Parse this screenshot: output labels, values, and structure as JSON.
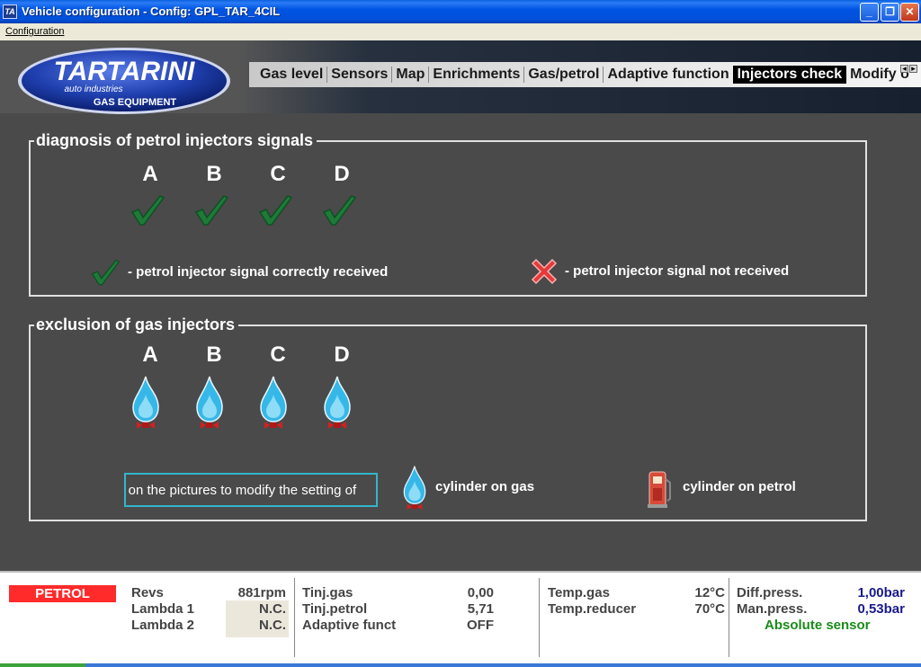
{
  "window": {
    "title": "Vehicle configuration - Config: GPL_TAR_4CIL",
    "app_icon": "TA",
    "minimize_icon": "minimize-icon",
    "maximize_icon": "restore-icon",
    "close_icon": "close-icon"
  },
  "menu": {
    "items": [
      "Configuration"
    ]
  },
  "logo": {
    "brand": "TARTARINI",
    "line1": "auto industries",
    "line2": "GAS EQUIPMENT"
  },
  "tabs": [
    "Gas level",
    "Sensors",
    "Map",
    "Enrichments",
    "Gas/petrol",
    "Adaptive function",
    "Injectors check",
    "Modify o"
  ],
  "active_tab": "Injectors check",
  "diagnosis": {
    "title": "diagnosis of petrol injectors signals",
    "injectors": [
      {
        "letter": "A",
        "status": "ok"
      },
      {
        "letter": "B",
        "status": "ok"
      },
      {
        "letter": "C",
        "status": "ok"
      },
      {
        "letter": "D",
        "status": "ok"
      }
    ],
    "legend_ok": "- petrol injector signal correctly received",
    "legend_fail": "- petrol injector signal not received"
  },
  "exclusion": {
    "title": "exclusion of gas injectors",
    "injectors": [
      {
        "letter": "A",
        "mode": "gas"
      },
      {
        "letter": "B",
        "mode": "gas"
      },
      {
        "letter": "C",
        "mode": "gas"
      },
      {
        "letter": "D",
        "mode": "gas"
      }
    ],
    "hint": "Click on the pictures to modify the setting of",
    "legend_gas": "cylinder on gas",
    "legend_petrol": "cylinder on petrol"
  },
  "status": {
    "mode": "PETROL",
    "revs_label": "Revs",
    "revs_value": "881rpm",
    "lambda1_label": "Lambda 1",
    "lambda1_value": "N.C.",
    "lambda2_label": "Lambda 2",
    "lambda2_value": "N.C.",
    "tinj_gas_label": "Tinj.gas",
    "tinj_gas_value": "0,00",
    "tinj_petrol_label": "Tinj.petrol",
    "tinj_petrol_value": "5,71",
    "adaptive_label": "Adaptive funct",
    "adaptive_value": "OFF",
    "temp_gas_label": "Temp.gas",
    "temp_gas_value": "12°C",
    "temp_reducer_label": "Temp.reducer",
    "temp_reducer_value": "70°C",
    "diff_press_label": "Diff.press.",
    "diff_press_value": "1,00bar",
    "man_press_label": "Man.press.",
    "man_press_value": "0,53bar",
    "sensor_type": "Absolute sensor"
  },
  "colors": {
    "accent_petrol": "#ff2a2a",
    "ok_green": "#1f7a3a",
    "gas_blue": "#33b6cc",
    "sensor_green": "#1a8c1a"
  }
}
